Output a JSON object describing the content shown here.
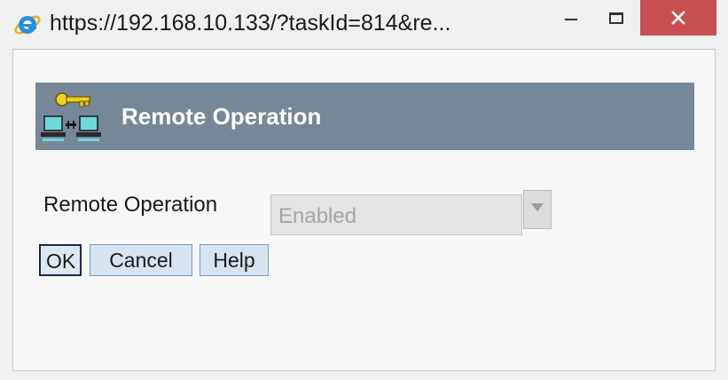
{
  "window": {
    "title": "https://192.168.10.133/?taskId=814&re...",
    "icon": "ie-browser-icon",
    "controls": {
      "minimize": "minimize-icon",
      "maximize": "maximize-icon",
      "close": "close-icon"
    }
  },
  "banner": {
    "title": "Remote Operation",
    "icon": "remote-operation-key-icon"
  },
  "form": {
    "field_label": "Remote Operation",
    "select_value": "Enabled",
    "select_icon": "chevron-down-icon"
  },
  "buttons": {
    "ok": "OK",
    "cancel": "Cancel",
    "help": "Help"
  },
  "colors": {
    "banner": "#768798",
    "close_button": "#c75050",
    "button_bg": "#d8e3f0",
    "button_border": "#7a9cc8"
  }
}
